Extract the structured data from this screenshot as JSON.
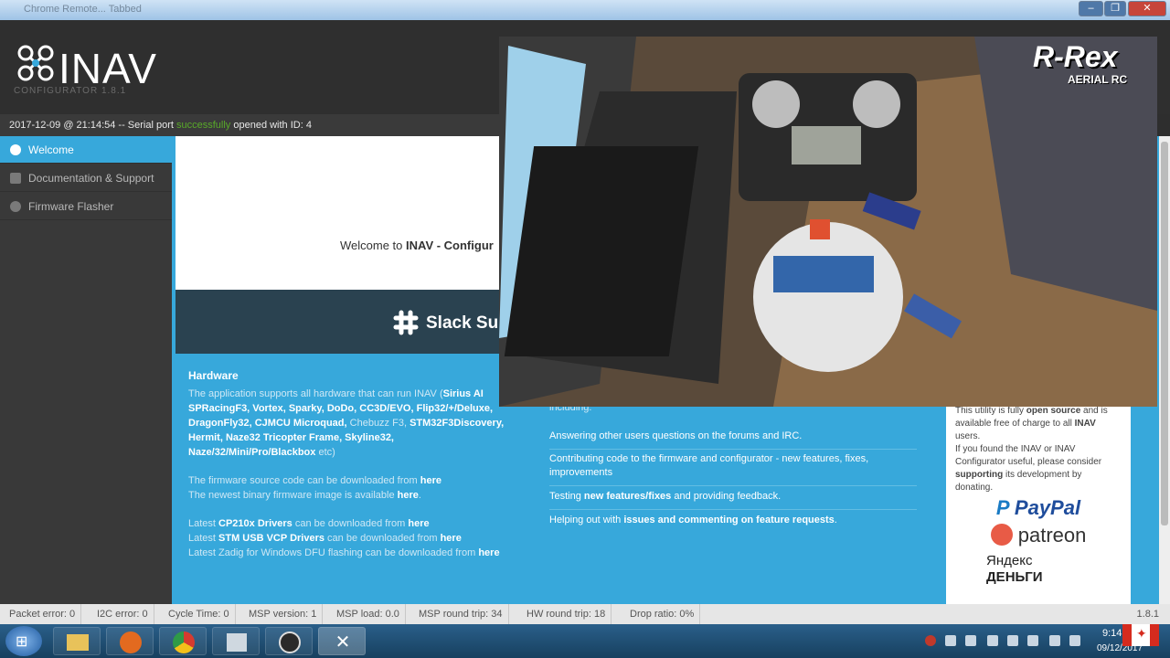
{
  "window": {
    "title": "Chrome Remote... Tabbed",
    "minimize": "–",
    "maximize": "❐",
    "close": "✕"
  },
  "header": {
    "logo": "INAV",
    "version": "CONFIGURATOR  1.8.1"
  },
  "log": {
    "prefix": "2017-12-09 @ 21:14:54 -- Serial port ",
    "ok": "successfully",
    "suffix": " opened with ID: 4"
  },
  "sidebar": {
    "items": [
      {
        "label": "Welcome"
      },
      {
        "label": "Documentation & Support"
      },
      {
        "label": "Firmware Flasher"
      }
    ]
  },
  "welcome": {
    "prefix": "Welcome to ",
    "bold": "INAV - Configur"
  },
  "slack": {
    "label": "Slack Sup"
  },
  "hardware": {
    "title": "Hardware",
    "l1": "The application supports all hardware that can run INAV (",
    "l1b": "Sirius AI",
    "l2": "SPRacingF3, Vortex, Sparky, DoDo, CC3D/EVO, Flip32/+/Deluxe,",
    "l3a": "DragonFly32, CJMCU Microquad, ",
    "l3b": "Chebuzz F3, ",
    "l3c": "STM32F3Discovery,",
    "l4": "Hermit, Naze32 Tricopter Frame, Skyline32,",
    "l5a": "Naze/32/Mini/Pro/Blackbox",
    "l5b": " etc)",
    "src_prefix": "The firmware source code can be downloaded from ",
    "bin_prefix": "The newest binary firmware image is available ",
    "here": "here",
    "cp_prefix": "Latest ",
    "cp_bold": "CP210x Drivers",
    "cp_suffix": " can be downloaded from ",
    "stm_bold": "STM USB VCP Drivers",
    "stm_suffix": " can be downloaded from ",
    "zadig_prefix": "Latest Zadig for Windows DFU flashing can be downloaded from ",
    "dot": "."
  },
  "contribute": {
    "including": "including:",
    "items": [
      {
        "text": "Answering other users questions on the forums and IRC."
      },
      {
        "text": "Contributing code to the firmware and configurator - new features, fixes, improvements"
      },
      {
        "pre": "Testing ",
        "bold": "new features/fixes",
        "post": " and providing feedback."
      },
      {
        "pre": "Helping out with ",
        "bold": "issues and commenting on feature requests",
        "post": "."
      }
    ]
  },
  "donate": {
    "l1a": "This utility is fully ",
    "l1b": "open source",
    "l1c": " and is",
    "l2a": "available free of charge to all ",
    "l2b": "INAV",
    "l3": "users.",
    "l4": "If you found the INAV or INAV",
    "l5": "Configurator useful, please consider",
    "l6a": "supporting",
    "l6b": " its development by",
    "l7": "donating.",
    "paypal": "PayPal",
    "patreon": "patreon",
    "yandex1": "Яндекс",
    "yandex2": "ДЕНЬГИ"
  },
  "overlay": {
    "brand": "R-Rex",
    "sub": "AERIAL RC"
  },
  "status": {
    "packet": "Packet error: 0",
    "i2c": "I2C error: 0",
    "cycle": "Cycle Time: 0",
    "msp": "MSP version: 1",
    "load": "MSP load: 0.0",
    "rtt": "MSP round trip: 34",
    "hw": "HW round trip: 18",
    "drop": "Drop ratio: 0%",
    "ver": "1.8.1"
  },
  "taskbar": {
    "time": "9:14",
    "date": "09/12/2017"
  },
  "colors": {
    "accent": "#37a8db",
    "ok": "#59aa29"
  }
}
